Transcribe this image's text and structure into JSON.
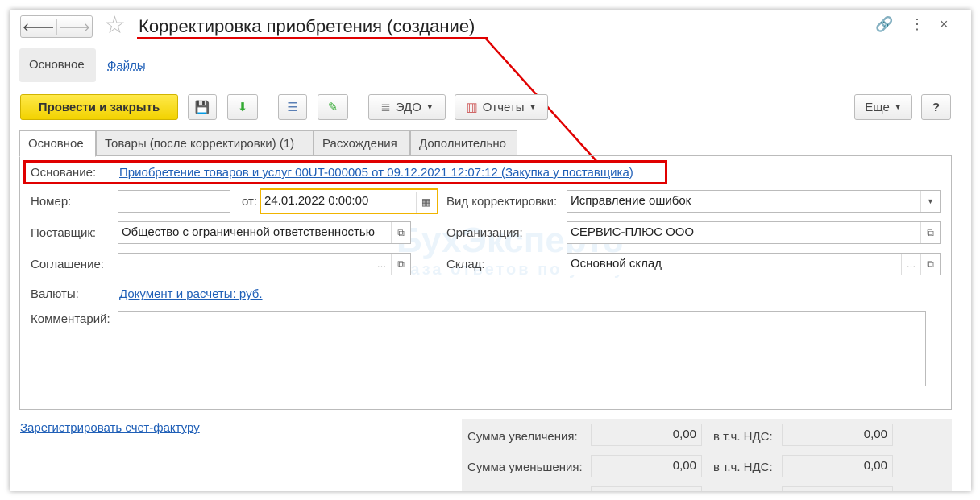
{
  "header": {
    "title": "Корректировка приобретения (создание)"
  },
  "sections": [
    {
      "label": "Основное"
    },
    {
      "label": "Файлы"
    }
  ],
  "toolbar": {
    "post_close": "Провести и закрыть",
    "edo": "ЭДО",
    "reports": "Отчеты",
    "more": "Еще",
    "help": "?"
  },
  "tabs": [
    {
      "label": "Основное"
    },
    {
      "label": "Товары (после корректировки) (1)"
    },
    {
      "label": "Расхождения"
    },
    {
      "label": "Дополнительно"
    }
  ],
  "form": {
    "basis_label": "Основание:",
    "basis_value": "Приобретение товаров и услуг 00UT-000005 от 09.12.2021 12:07:12 (Закупка у поставщика)",
    "number_label": "Номер:",
    "number_value": "",
    "date_label": "от:",
    "date_value": "24.01.2022  0:00:00",
    "kind_label": "Вид корректировки:",
    "kind_value": "Исправление ошибок",
    "supplier_label": "Поставщик:",
    "supplier_value": "Общество с ограниченной ответственностью",
    "org_label": "Организация:",
    "org_value": "СЕРВИС-ПЛЮС ООО",
    "agreement_label": "Соглашение:",
    "agreement_value": "",
    "warehouse_label": "Склад:",
    "warehouse_value": "Основной склад",
    "currency_label": "Валюты:",
    "currency_value": "Документ и расчеты: руб.",
    "comment_label": "Комментарий:",
    "comment_value": ""
  },
  "footer": {
    "invoice_link": "Зарегистрировать счет-фактуру",
    "inc_label": "Сумма увеличения:",
    "inc_value": "0,00",
    "inc_vat_label": "в т.ч. НДС:",
    "inc_vat_value": "0,00",
    "dec_label": "Сумма уменьшения:",
    "dec_value": "0,00",
    "dec_vat_label": "в т.ч. НДС:",
    "dec_vat_value": "0,00"
  },
  "watermark": {
    "brand": "БухЭксперт8",
    "tagline": "База ответов по учету в 1С"
  },
  "colors": {
    "accent_yellow": "#f5d800",
    "annotation_red": "#e00000",
    "date_focus": "#f0b400",
    "link": "#1f5fb7"
  }
}
